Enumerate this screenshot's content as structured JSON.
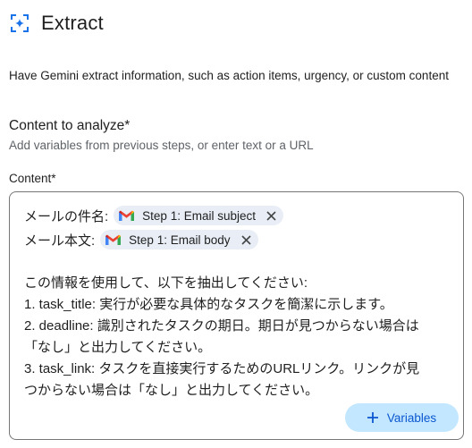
{
  "header": {
    "title": "Extract",
    "icon": "sparkle-frame-icon"
  },
  "description": "Have Gemini extract information, such as action items, urgency, or custom content",
  "section": {
    "title": "Content to analyze*",
    "subtitle": "Add variables from previous steps, or enter text or a URL"
  },
  "content": {
    "label": "Content*",
    "lines": [
      {
        "prefix": "メールの件名:",
        "chip": "Step 1: Email subject"
      },
      {
        "prefix": "メール本文:",
        "chip": "Step 1: Email body"
      }
    ],
    "body_lines": [
      "この情報を使用して、以下を抽出してください:",
      "1. task_title: 実行が必要な具体的なタスクを簡潔に示します。",
      "2. deadline: 識別されたタスクの期日。期日が見つからない場合は",
      "「なし」と出力してください。",
      "3. task_link: タスクを直接実行するためのURLリンク。リンクが見",
      "つからない場合は「なし」と出力してください。"
    ],
    "variables_button": "Variables"
  },
  "colors": {
    "accent": "#0b57d0",
    "chip_bg": "#e9eef6",
    "button_bg": "#c2e7ff"
  }
}
